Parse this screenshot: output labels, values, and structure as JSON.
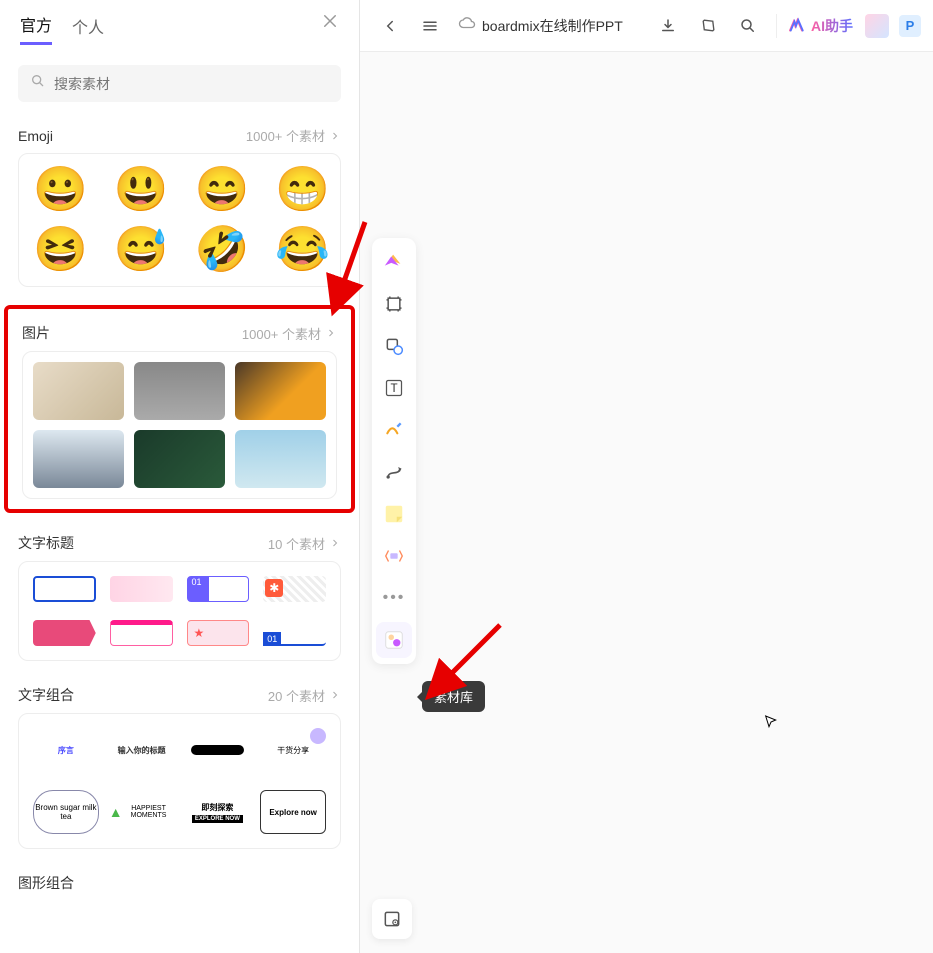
{
  "tabs": {
    "official": "官方",
    "personal": "个人"
  },
  "search": {
    "placeholder": "搜索素材"
  },
  "sections": {
    "emoji": {
      "title": "Emoji",
      "meta": "1000+ 个素材",
      "items": [
        "😀",
        "😃",
        "😄",
        "😁",
        "😆",
        "😅",
        "🤣",
        "😂"
      ]
    },
    "image": {
      "title": "图片",
      "meta": "1000+ 个素材"
    },
    "textTitle": {
      "title": "文字标题",
      "meta": "10 个素材"
    },
    "textCombo": {
      "title": "文字组合",
      "meta": "20 个素材"
    },
    "shapeCombo": {
      "title": "图形组合",
      "meta": ""
    }
  },
  "topbar": {
    "title": "boardmix在线制作PPT",
    "ai": "AI助手",
    "badge": "P"
  },
  "tooltip": "素材库",
  "textCombos": {
    "c1": "序言",
    "c2": "输入你的标题",
    "c4": "干货分享",
    "c5": "Brown sugar milk tea",
    "c6": "HAPPIEST MOMENTS",
    "c7": "即刻探索",
    "c8": "Explore now"
  }
}
